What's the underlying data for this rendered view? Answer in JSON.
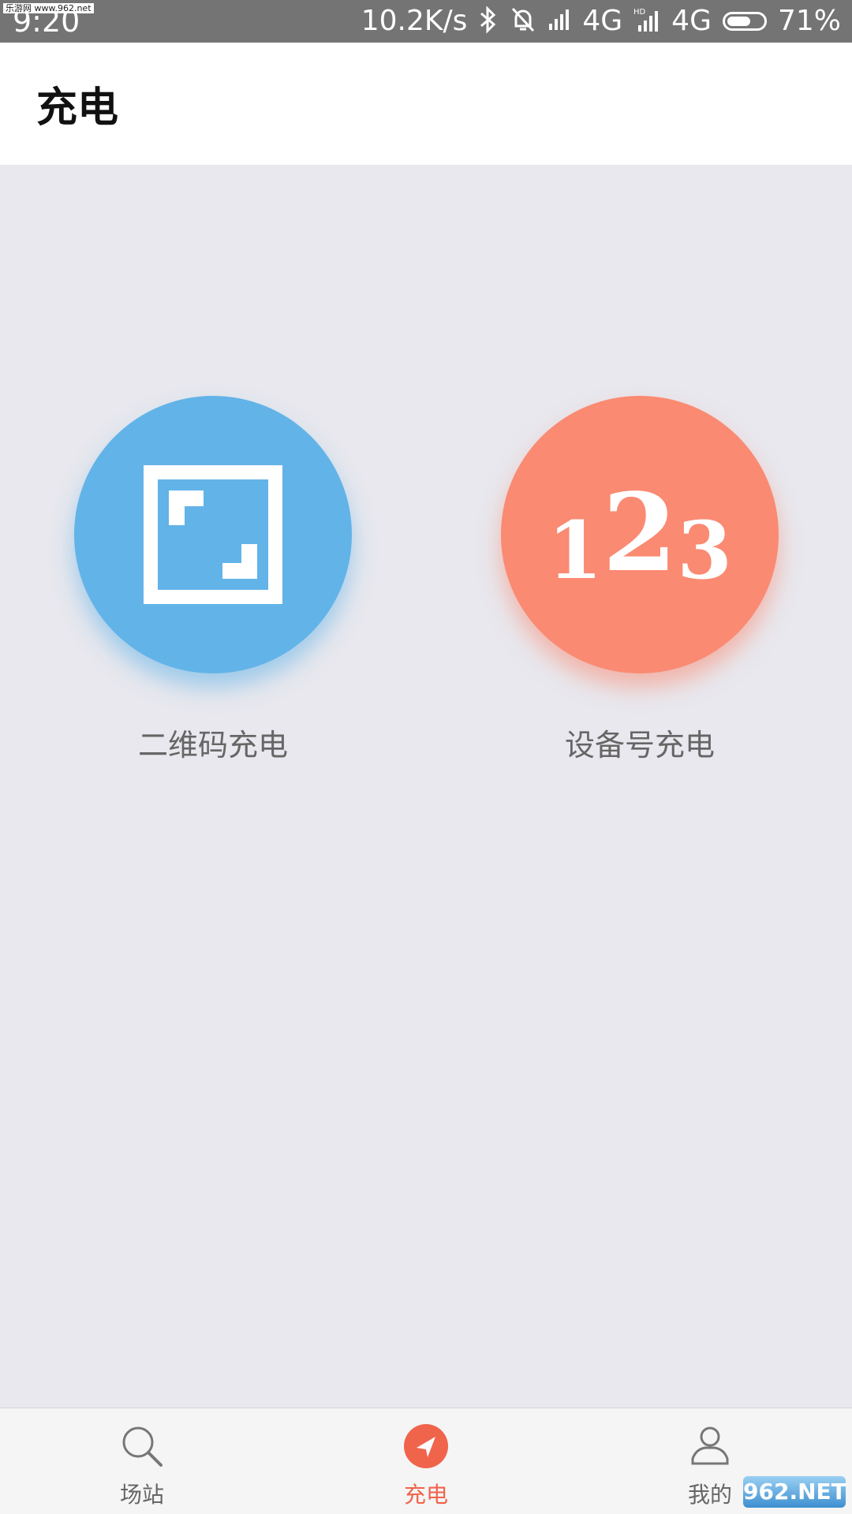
{
  "status_bar": {
    "time": "9:20",
    "watermark": "乐游网 www.962.net",
    "net_speed": "10.2K/s",
    "sim1": "4G",
    "sim2": "4G",
    "battery_percent": "71%",
    "battery_level": 0.71,
    "icons": [
      "bluetooth-icon",
      "alarm-off-icon",
      "signal-icon",
      "hd-signal-icon",
      "battery-icon"
    ]
  },
  "header": {
    "title": "充电"
  },
  "actions": {
    "qr": {
      "label": "二维码充电",
      "icon": "scan-icon",
      "color": "#62b3e8"
    },
    "device": {
      "label": "设备号充电",
      "digits": [
        "1",
        "2",
        "3"
      ],
      "color": "#fa8a72"
    }
  },
  "bottom_nav": {
    "items": [
      {
        "label": "场站",
        "icon": "search-icon",
        "active": false
      },
      {
        "label": "充电",
        "icon": "navigation-arrow-icon",
        "active": true
      },
      {
        "label": "我的",
        "icon": "user-icon",
        "active": false
      }
    ],
    "active_color": "#f0644c"
  },
  "watermark_logo": "962.NET"
}
